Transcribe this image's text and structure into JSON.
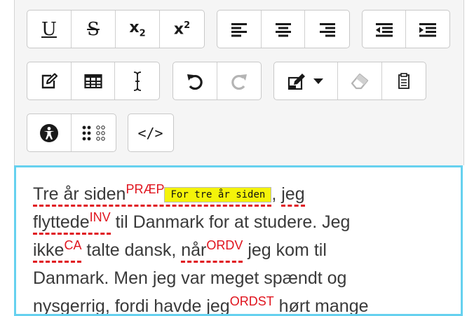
{
  "toolbar": {
    "underline_label": "U",
    "strikethrough_label": "S",
    "subscript": {
      "base": "x",
      "sub": "2"
    },
    "superscript": {
      "base": "x",
      "sup": "2"
    },
    "icons": [
      "underline-icon",
      "strikethrough-icon",
      "subscript-icon",
      "superscript-icon",
      "align-left-icon",
      "align-center-icon",
      "align-right-icon",
      "outdent-icon",
      "indent-icon",
      "edit-icon",
      "table-icon",
      "text-cursor-icon",
      "undo-icon",
      "redo-icon",
      "highlighter-icon",
      "dropdown-caret-icon",
      "eraser-icon",
      "clipboard-icon",
      "accessibility-icon",
      "braille-icon",
      "code-icon"
    ],
    "code_label": "</>",
    "redo_disabled": true,
    "eraser_disabled": true
  },
  "editor": {
    "line1": {
      "w1": "Tre år siden",
      "tag1": "PRÆP",
      "suggestion": "For tre år siden",
      "sep": ", ",
      "w2": "jeg"
    },
    "line2": {
      "w1": "flyttede",
      "tag1": "INV",
      "rest": " til Danmark for at studere. Jeg"
    },
    "line3": {
      "w1": "ikke",
      "tag1": "CA",
      "mid": " talte dansk, ",
      "w2": "når",
      "tag2": "ORDV",
      "rest": " jeg kom til"
    },
    "line4": {
      "text": "Danmark. Men jeg var meget spændt og"
    },
    "line5": {
      "pre": "nysgerrig, fordi havde jeg",
      "tag1": "ORDST",
      "rest": " hørt mange"
    }
  },
  "colors": {
    "error": "#e0141e",
    "suggestion_bg": "#f4f30a",
    "focus_border": "#66d1ef"
  }
}
